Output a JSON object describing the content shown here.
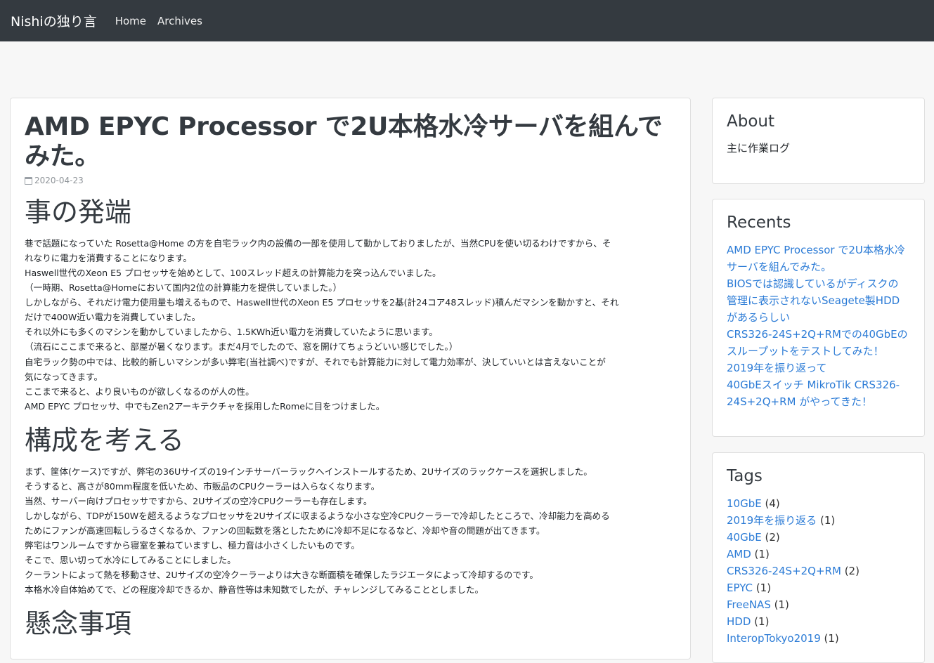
{
  "navbar": {
    "brand": "Nishiの独り言",
    "links": [
      "Home",
      "Archives"
    ]
  },
  "post": {
    "title": "AMD EPYC Processor で2U本格水冷サーバを組んでみた。",
    "date": "2020-04-23",
    "sections": [
      {
        "heading": "事の発端",
        "lines": [
          "巷で話題になっていた Rosetta@Home の方を自宅ラック内の設備の一部を使用して動かしておりましたが、当然CPUを使い切るわけですから、そ",
          "れなりに電力を消費することになります。",
          "Haswell世代のXeon E5 プロセッサを始めとして、100スレッド超えの計算能力を突っ込んでいました。",
          "（一時期、Rosetta@Homeにおいて国内2位の計算能力を提供していました。）",
          "しかしながら、それだけ電力使用量も増えるもので、Haswell世代のXeon E5 プロセッサを2基(計24コア48スレッド)積んだマシンを動かすと、それ",
          "だけで400W近い電力を消費していました。",
          "それ以外にも多くのマシンを動かしていましたから、1.5KWh近い電力を消費していたように思います。",
          "（流石にここまで来ると、部屋が暑くなります。まだ4月でしたので、窓を開けてちょうどいい感じでした。）",
          "自宅ラック勢の中では、比較的新しいマシンが多い弊宅(当社調べ)ですが、それでも計算能力に対して電力効率が、決していいとは言えないことが",
          "気になってきます。",
          "ここまで来ると、より良いものが欲しくなるのが人の性。",
          "AMD EPYC プロセッサ、中でもZen2アーキテクチャを採用したRomeに目をつけました。"
        ]
      },
      {
        "heading": "構成を考える",
        "lines": [
          "まず、筐体(ケース)ですが、弊宅の36Uサイズの19インチサーバーラックへインストールするため、2Uサイズのラックケースを選択しました。",
          "そうすると、高さが80mm程度を低いため、市販品のCPUクーラーは入らなくなります。",
          "当然、サーバー向けプロセッサですから、2Uサイズの空冷CPUクーラーも存在します。",
          "しかしながら、TDPが150Wを超えるようなプロセッサを2Uサイズに収まるような小さな空冷CPUクーラーで冷却したところで、冷却能力を高める",
          "ためにファンが高速回転しうるさくなるか、ファンの回転数を落としたために冷却不足になるなど、冷却や音の問題が出てきます。",
          "弊宅はワンルームですから寝室を兼ねていますし、極力音は小さくしたいものです。",
          "そこで、思い切って水冷にしてみることにしました。",
          "クーラントによって熱を移動させ、2Uサイズの空冷クーラーよりは大きな断面積を確保したラジエータによって冷却するのです。",
          "本格水冷自体始めてで、どの程度冷却できるか、静音性等は未知数でしたが、チャレンジしてみることとしました。"
        ]
      },
      {
        "heading": "懸念事項",
        "lines": []
      }
    ]
  },
  "sidebar": {
    "about": {
      "title": "About",
      "text": "主に作業ログ"
    },
    "recents": {
      "title": "Recents",
      "items": [
        {
          "lines": [
            "AMD EPYC Processor で2U本格水冷",
            "サーバを組んでみた。"
          ]
        },
        {
          "lines": [
            "BIOSでは認識しているがディスクの",
            "管理に表示されないSeagete製HDD",
            "があるらしい"
          ]
        },
        {
          "lines": [
            "CRS326-24S+2Q+RMでの40GbEの",
            "スループットをテストしてみた！"
          ]
        },
        {
          "lines": [
            "2019年を振り返って"
          ]
        },
        {
          "lines": [
            "40GbEスイッチ MikroTik CRS326-",
            "24S+2Q+RM がやってきた！"
          ]
        }
      ]
    },
    "tags": {
      "title": "Tags",
      "items": [
        {
          "name": "10GbE",
          "count": "(4)"
        },
        {
          "name": "2019年を振り返る",
          "count": "(1)"
        },
        {
          "name": "40GbE",
          "count": "(2)"
        },
        {
          "name": "AMD",
          "count": "(1)"
        },
        {
          "name": "CRS326-24S+2Q+RM",
          "count": "(2)"
        },
        {
          "name": "EPYC",
          "count": "(1)"
        },
        {
          "name": "FreeNAS",
          "count": "(1)"
        },
        {
          "name": "HDD",
          "count": "(1)"
        },
        {
          "name": "InteropTokyo2019",
          "count": "(1)"
        }
      ]
    }
  }
}
